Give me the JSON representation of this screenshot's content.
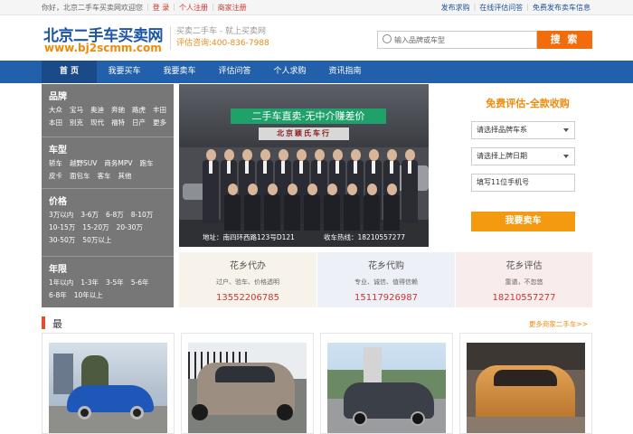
{
  "topbar": {
    "welcome": "你好，北京二手车买卖网欢迎您",
    "login": "登 录",
    "register": "个人注册",
    "dealer_register": "商家注册",
    "links": [
      "发布求购",
      "在线评估问答",
      "免费发布卖车信息"
    ]
  },
  "header": {
    "logo_cn": "北京二手车买卖网",
    "logo_url": "www.bj2scmm.com",
    "slogan": "买卖二手车 - 就上买卖网",
    "hotline": "评估咨询:400-836-7988",
    "search_placeholder": "输入品牌或车型",
    "search_button": "搜 索"
  },
  "nav": [
    "首 页",
    "我要买车",
    "我要卖车",
    "评估问答",
    "个人求购",
    "资讯指南"
  ],
  "filters": {
    "brand": {
      "title": "品牌",
      "items": [
        "大众",
        "宝马",
        "奥迪",
        "奔驰",
        "路虎",
        "丰田",
        "本田",
        "别克",
        "现代",
        "福特",
        "日产",
        "更多"
      ]
    },
    "type": {
      "title": "车型",
      "items": [
        "轿车",
        "越野SUV",
        "商务MPV",
        "跑车",
        "皮卡",
        "面包车",
        "客车",
        "其他"
      ]
    },
    "price": {
      "title": "价格",
      "items": [
        "3万以内",
        "3-6万",
        "6-8万",
        "8-10万",
        "10-15万",
        "15-20万",
        "20-30万",
        "30-50万",
        "50万以上"
      ]
    },
    "age": {
      "title": "年限",
      "items": [
        "1年以内",
        "1-3年",
        "3-5年",
        "5-6年",
        "6-8年",
        "10年以上"
      ]
    }
  },
  "banner": {
    "headline": "二手车直卖-无中介赚差价",
    "sign": "北京颖氏车行",
    "address": "地址：南四环西路123号D121",
    "phone": "收车热线：18210557277"
  },
  "form": {
    "title": "免费评估-全款收购",
    "brand_select": "请选择品牌车系",
    "date_select": "请选择上牌日期",
    "phone_placeholder": "填写11位手机号",
    "submit": "我要卖车"
  },
  "services": [
    {
      "name": "花乡代办",
      "desc": "过户、验车、价格透明",
      "phone": "13552206785",
      "bg": "#f7f3ea"
    },
    {
      "name": "花乡代购",
      "desc": "专业、诚信、值得信赖",
      "phone": "15117926987",
      "bg": "#edf0f6"
    },
    {
      "name": "花乡评估",
      "desc": "靠谱，不忽悠",
      "phone": "18210557277",
      "bg": "#f8ecec"
    }
  ],
  "latest": {
    "title": "最新商家二手车",
    "more": "更多商家二手车>>"
  },
  "colors": {
    "brand_blue": "#2360ab",
    "accent_orange": "#f06c0c",
    "price_red": "#d0352c"
  }
}
